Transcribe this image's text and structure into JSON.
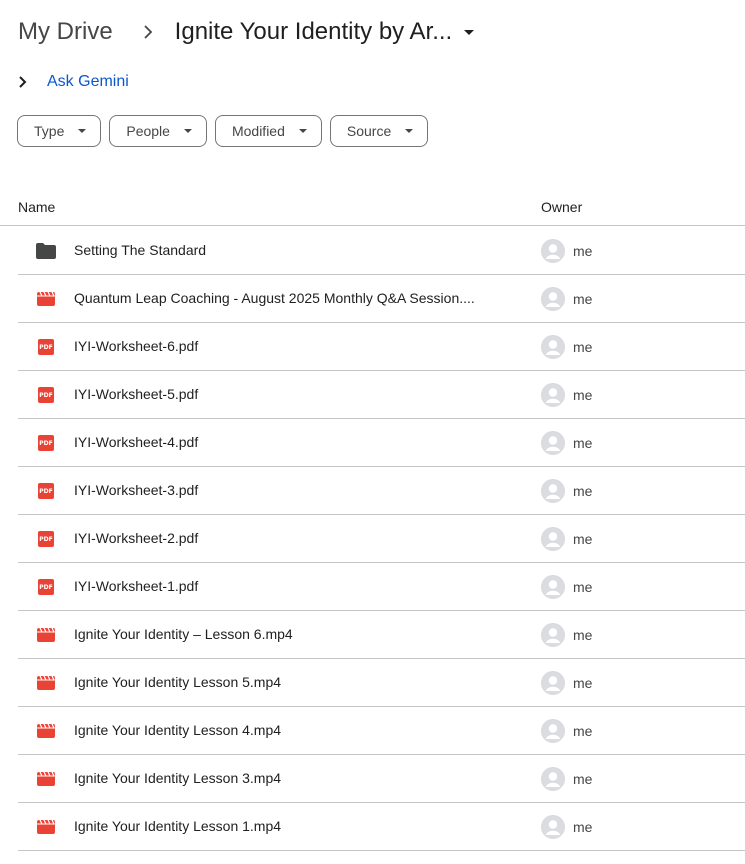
{
  "breadcrumb": {
    "root": "My Drive",
    "current": "Ignite Your Identity by Ar..."
  },
  "gemini": {
    "label": "Ask Gemini"
  },
  "filters": [
    {
      "label": "Type"
    },
    {
      "label": "People"
    },
    {
      "label": "Modified"
    },
    {
      "label": "Source"
    }
  ],
  "table": {
    "headers": {
      "name": "Name",
      "owner": "Owner"
    },
    "rows": [
      {
        "name": "Setting The Standard",
        "type": "folder",
        "icon": "folder-icon",
        "owner": "me"
      },
      {
        "name": "Quantum Leap Coaching - August 2025 Monthly Q&A Session....",
        "type": "video",
        "icon": "video-icon",
        "owner": "me"
      },
      {
        "name": "IYI-Worksheet-6.pdf",
        "type": "pdf",
        "icon": "pdf-icon",
        "owner": "me"
      },
      {
        "name": "IYI-Worksheet-5.pdf",
        "type": "pdf",
        "icon": "pdf-icon",
        "owner": "me"
      },
      {
        "name": "IYI-Worksheet-4.pdf",
        "type": "pdf",
        "icon": "pdf-icon",
        "owner": "me"
      },
      {
        "name": "IYI-Worksheet-3.pdf",
        "type": "pdf",
        "icon": "pdf-icon",
        "owner": "me"
      },
      {
        "name": "IYI-Worksheet-2.pdf",
        "type": "pdf",
        "icon": "pdf-icon",
        "owner": "me"
      },
      {
        "name": "IYI-Worksheet-1.pdf",
        "type": "pdf",
        "icon": "pdf-icon",
        "owner": "me"
      },
      {
        "name": "Ignite Your Identity – Lesson 6.mp4",
        "type": "video",
        "icon": "video-icon",
        "owner": "me"
      },
      {
        "name": "Ignite Your Identity Lesson 5.mp4",
        "type": "video",
        "icon": "video-icon",
        "owner": "me"
      },
      {
        "name": "Ignite Your Identity Lesson 4.mp4",
        "type": "video",
        "icon": "video-icon",
        "owner": "me"
      },
      {
        "name": "Ignite Your Identity Lesson 3.mp4",
        "type": "video",
        "icon": "video-icon",
        "owner": "me"
      },
      {
        "name": "Ignite Your Identity Lesson 1.mp4",
        "type": "video",
        "icon": "video-icon",
        "owner": "me"
      }
    ]
  },
  "colors": {
    "link_blue": "#0b57d0",
    "file_red": "#ea4335",
    "folder_gray": "#444746",
    "divider": "#c4c7c5"
  }
}
